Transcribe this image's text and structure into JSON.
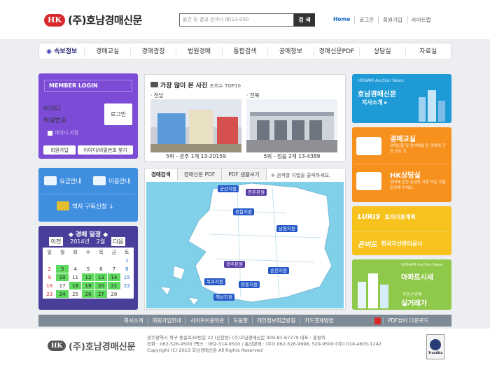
{
  "header": {
    "logo_badge": "HK",
    "logo_name": "(주)호남경매신문",
    "search_placeholder": "물건 및 결과 검색시 예)13-000",
    "search_button": "검 색",
    "links": [
      "Home",
      "로그인",
      "회원가입",
      "사이트맵"
    ]
  },
  "nav": [
    "속보정보",
    "경매교실",
    "경매광장",
    "법원경매",
    "통합검색",
    "공매정보",
    "경매신문PDF",
    "상담실",
    "자료실"
  ],
  "login": {
    "title": "MEMBER LOGIN",
    "id_placeholder": "아이디",
    "pw_placeholder": "비밀번호",
    "login_button": "로그인",
    "save_id": "아이디 저장",
    "join_button": "회원가입",
    "find_button": "아이디/비밀번호 찾기"
  },
  "services": {
    "fee": "요금안내",
    "usage": "이용안내",
    "book": "책자 구독신청 ↓"
  },
  "calendar": {
    "title": "◆ 경매 일정 ◆",
    "prev": "이전",
    "year": "2014년",
    "month": "2월",
    "next": "다음",
    "weekdays": [
      "일",
      "월",
      "화",
      "수",
      "목",
      "금",
      "토"
    ],
    "rows": [
      [
        "",
        "",
        "",
        "",
        "",
        "",
        "1"
      ],
      [
        "2",
        "3",
        "4",
        "5",
        "6",
        "7",
        "8"
      ],
      [
        "9",
        "10",
        "11",
        "12",
        "13",
        "14",
        "15"
      ],
      [
        "16",
        "17",
        "18",
        "19",
        "20",
        "21",
        "22"
      ],
      [
        "23",
        "24",
        "25",
        "26",
        "27",
        "28",
        ""
      ]
    ],
    "highlighted_days": [
      "3",
      "10",
      "12",
      "13",
      "14",
      "18",
      "19",
      "20",
      "21",
      "24",
      "26",
      "27"
    ]
  },
  "photos": {
    "title": "가장 많이 본 사진",
    "subtitle": "조회수 TOP10",
    "items": [
      {
        "region": "· 전남",
        "caption": "5위 - 광주 1계 13-20159"
      },
      {
        "region": "· 전북",
        "caption": "5위 - 정읍 2계 13-4389"
      }
    ]
  },
  "map": {
    "tabs": [
      "경매검색",
      "경매신문 PDF",
      "PDF 샘플보기"
    ],
    "note": "※ 검색할 지법을 클릭하세요.",
    "courts": [
      "군산지원",
      "전주본원",
      "정읍지원",
      "남원지원",
      "광주본원",
      "순천지원",
      "목포지원",
      "장흥지원",
      "해남지원"
    ]
  },
  "banners": {
    "b1_tag": "HONAM Auction News",
    "b1_title": "호남경매신문",
    "b1_sub": "지사소개 ▸",
    "b2_title": "경매교실",
    "b2_desc": "경매입찰 및 용어해설 등 경매에 관한 모든 것",
    "b3_title": "HK상담실",
    "b3_desc": "경매에 관한 궁금한 사항 모든 것을 문의해 주세요.",
    "b4_logo": "LURIS",
    "b4_title": "토지이용계획",
    "b5_logo": "온비드",
    "b5_title": "한국자산관리공사",
    "b6_tag": "HONAM Auction News",
    "b6_title": "아파트시세",
    "b6_sub": "부동산경매",
    "b7_title": "실거래가"
  },
  "footer_nav": {
    "links": [
      "회사소개",
      "회원가입안내",
      "사이트이용약관",
      "도움말",
      "개인정보취급방침",
      "카드결제방법"
    ],
    "pdf": "PDF뷰어 다운로드"
  },
  "footer": {
    "logo_badge": "HK",
    "logo_name": "(주)호남경매신문",
    "address": "광주광역시 북구 중흥로39번길 22 (신안동) (주)호남경매신문 409-81-67279 대표 : 홍왕의",
    "phone": "전화 : 062-526-9500 (팩스 : 062-514-9500 / 통신판매 : (주)) 062-526-9998, 529-9500 (이)) 010-4605-1242",
    "copyright": "Copyright (C) 2013 호남경매신문 All Rights Reserved",
    "cert_text": "TrustBiz"
  },
  "colors": {
    "accent": "#7c4cd6",
    "blue": "#3f8ee0",
    "orange": "#f7911e",
    "yellow": "#f6c21b",
    "green": "#8fc94a"
  }
}
